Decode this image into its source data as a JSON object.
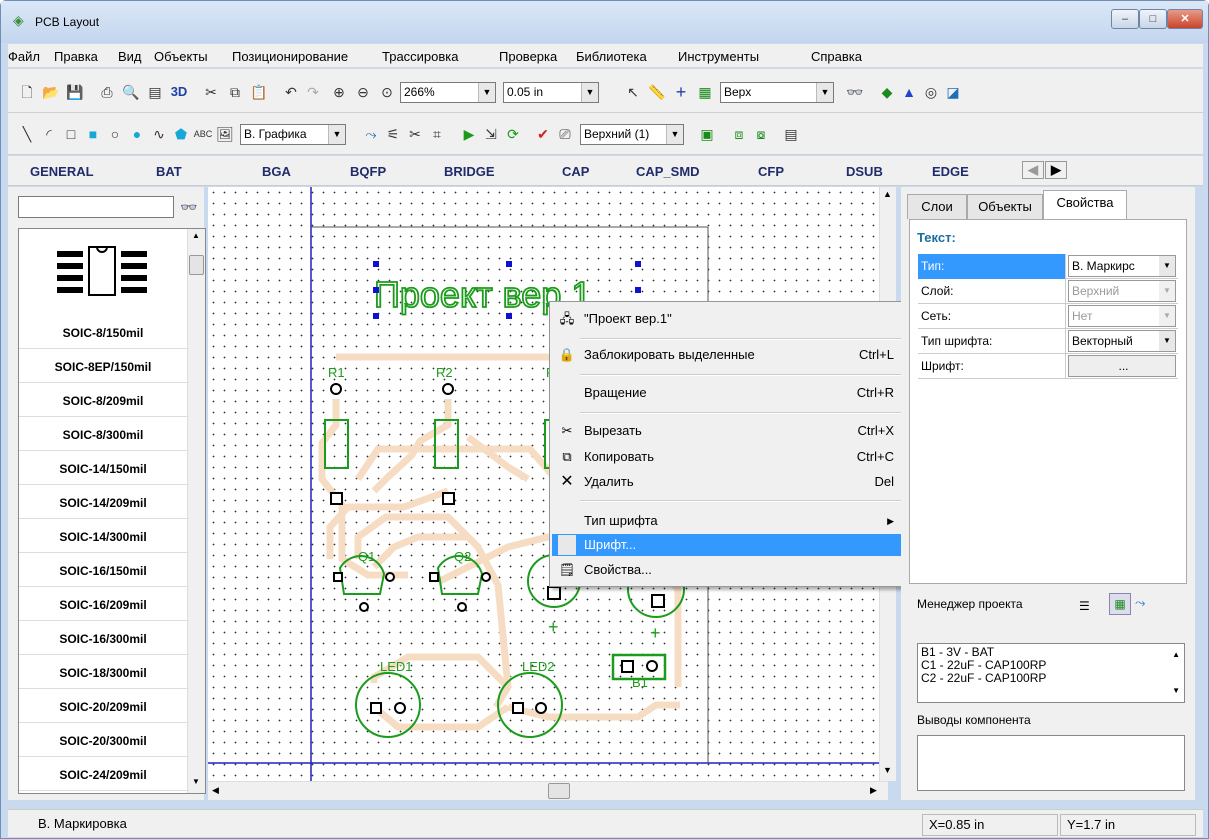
{
  "window": {
    "title": "PCB Layout",
    "min": "–",
    "max": "□",
    "close": "✕"
  },
  "menu": [
    "Файл",
    "Правка",
    "Вид",
    "Объекты",
    "Позиционирование",
    "Трассировка",
    "Проверка",
    "Библиотека",
    "Инструменты",
    "Справка"
  ],
  "toolbar1": {
    "zoom": "266%",
    "grid": "0.05 in",
    "layer": "Верх",
    "btn3d": "3D"
  },
  "toolbar2": {
    "graphics": "В. Графика",
    "side": "Верхний (1)",
    "abc": "ABC"
  },
  "libtabs": [
    "GENERAL",
    "BAT",
    "BGA",
    "BQFP",
    "BRIDGE",
    "CAP",
    "CAP_SMD",
    "CFP",
    "DSUB",
    "EDGE"
  ],
  "library": {
    "search_value": "",
    "items": [
      "SOIC-8/150mil",
      "SOIC-8EP/150mil",
      "SOIC-8/209mil",
      "SOIC-8/300mil",
      "SOIC-14/150mil",
      "SOIC-14/209mil",
      "SOIC-14/300mil",
      "SOIC-16/150mil",
      "SOIC-16/209mil",
      "SOIC-16/300mil",
      "SOIC-18/300mil",
      "SOIC-20/209mil",
      "SOIC-20/300mil",
      "SOIC-24/209mil"
    ]
  },
  "canvas": {
    "text_label": "Проект вер.1",
    "parts": [
      "R1",
      "R2",
      "R",
      "Q1",
      "Q2",
      "LED1",
      "LED2",
      "B1",
      "+",
      "+"
    ]
  },
  "context_menu": {
    "title": "\"Проект вер.1\"",
    "items": [
      {
        "label": "Заблокировать выделенные",
        "shortcut": "Ctrl+L"
      },
      {
        "label": "Вращение",
        "shortcut": "Ctrl+R"
      },
      {
        "label": "Вырезать",
        "shortcut": "Ctrl+X"
      },
      {
        "label": "Копировать",
        "shortcut": "Ctrl+C"
      },
      {
        "label": "Удалить",
        "shortcut": "Del"
      },
      {
        "label": "Тип шрифта",
        "shortcut": "▶"
      },
      {
        "label": "Шрифт...",
        "shortcut": ""
      },
      {
        "label": "Свойства...",
        "shortcut": ""
      }
    ]
  },
  "right_panel": {
    "tabs": [
      "Слои",
      "Объекты",
      "Свойства"
    ],
    "section": "Текст:",
    "props": [
      {
        "key": "Тип:",
        "value": "В. Маркирс"
      },
      {
        "key": "Слой:",
        "value": "Верхний"
      },
      {
        "key": "Сеть:",
        "value": "Нет"
      },
      {
        "key": "Тип шрифта:",
        "value": "Векторный"
      },
      {
        "key": "Шрифт:",
        "value": "..."
      }
    ],
    "project_manager": "Менеджер проекта",
    "project_items": [
      "B1 - 3V - BAT",
      "C1 - 22uF - CAP100RP",
      "C2 - 22uF - CAP100RP"
    ],
    "pins_title": "Выводы компонента"
  },
  "status": {
    "left": "В. Маркировка",
    "x": "X=0.85 in",
    "y": "Y=1.7 in"
  }
}
